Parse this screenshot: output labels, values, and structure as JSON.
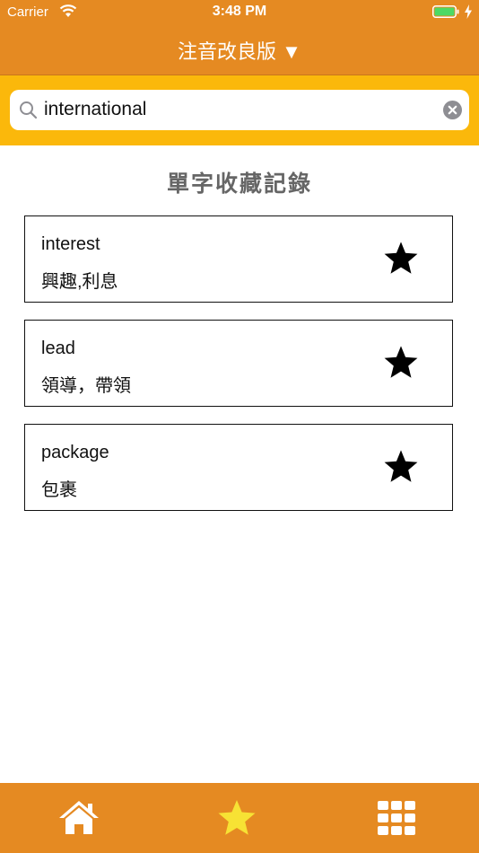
{
  "status_bar": {
    "carrier": "Carrier",
    "time": "3:48 PM"
  },
  "nav": {
    "title": "注音改良版 ▼"
  },
  "search": {
    "value": "international"
  },
  "section": {
    "title": "單字收藏記錄"
  },
  "favorites": [
    {
      "word": "interest",
      "meaning": "興趣,利息"
    },
    {
      "word": "lead",
      "meaning": "領導，帶領"
    },
    {
      "word": "package",
      "meaning": "包裹"
    }
  ],
  "tabs": [
    {
      "icon": "home-icon"
    },
    {
      "icon": "star-icon",
      "active": true
    },
    {
      "icon": "grid-icon"
    }
  ],
  "colors": {
    "header": "#e58a22",
    "search_bg": "#fbb80b",
    "active_tab": "#f7e234",
    "title_gray": "#666666",
    "battery_green": "#4cd964"
  }
}
